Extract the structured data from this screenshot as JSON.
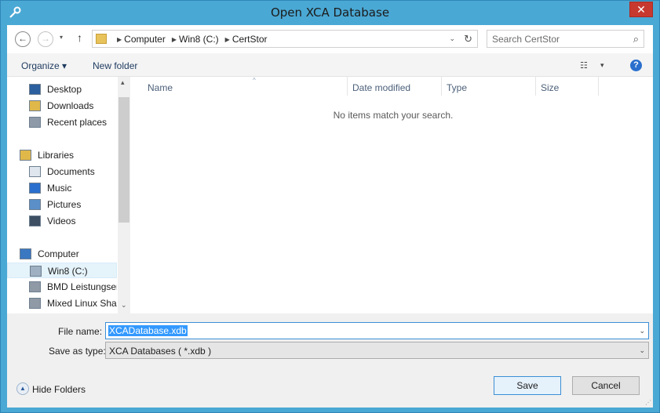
{
  "window": {
    "title": "Open XCA Database",
    "close_symbol": "✕"
  },
  "address": {
    "back_symbol": "←",
    "forward_symbol": "→",
    "recent_symbol": "▾",
    "up_symbol": "↑",
    "breadcrumbs": [
      "Computer",
      "Win8 (C:)",
      "CertStor"
    ],
    "crumb_sep": "▶",
    "dropdown_symbol": "⌄",
    "refresh_symbol": "↻"
  },
  "search": {
    "placeholder": "Search CertStor",
    "icon_symbol": "⌕"
  },
  "toolbar": {
    "organize": "Organize ▾",
    "new_folder": "New folder",
    "view_symbol": "☷",
    "view_drop_symbol": "▾",
    "help_symbol": "?"
  },
  "nav": {
    "items": [
      {
        "label": "Desktop",
        "icon": "desktop-icon",
        "color": "#2b5f9e"
      },
      {
        "label": "Downloads",
        "icon": "downloads-icon",
        "color": "#e0b84a"
      },
      {
        "label": "Recent places",
        "icon": "recent-places-icon",
        "color": "#8e9aa8"
      },
      {
        "label": "Libraries",
        "icon": "libraries-icon",
        "color": "#e0b84a"
      },
      {
        "label": "Documents",
        "icon": "documents-icon",
        "color": "#dfe6ee"
      },
      {
        "label": "Music",
        "icon": "music-icon",
        "color": "#2a6fcd"
      },
      {
        "label": "Pictures",
        "icon": "pictures-icon",
        "color": "#5a8fc8"
      },
      {
        "label": "Videos",
        "icon": "videos-icon",
        "color": "#3d4f63"
      },
      {
        "label": "Computer",
        "icon": "computer-icon",
        "color": "#3a78c2"
      },
      {
        "label": "Win8 (C:)",
        "icon": "drive-icon",
        "color": "#9fb0c2"
      },
      {
        "label": "BMD Leistungser",
        "icon": "network-drive-icon",
        "color": "#8f9aa6"
      },
      {
        "label": "Mixed Linux Shar",
        "icon": "network-drive-icon",
        "color": "#8f9aa6"
      }
    ],
    "selected_index": 9,
    "scroll_up": "▴",
    "scroll_down": "⌄"
  },
  "columns": [
    "Name",
    "Date modified",
    "Type",
    "Size"
  ],
  "sort_symbol": "^",
  "empty_message": "No items match your search.",
  "form": {
    "file_name_label": "File name:",
    "file_name_value": "XCADatabase.xdb",
    "save_type_label": "Save as type:",
    "save_type_value": "XCA Databases ( *.xdb )",
    "dropdown_symbol": "⌄"
  },
  "footer": {
    "hide_folders": "Hide Folders",
    "hide_folders_symbol": "▲",
    "save": "Save",
    "cancel": "Cancel"
  }
}
